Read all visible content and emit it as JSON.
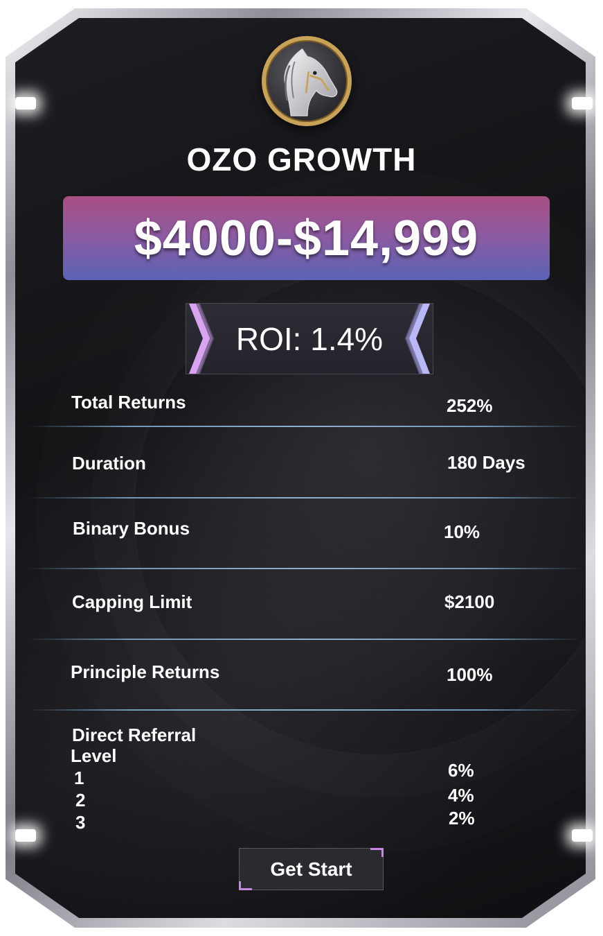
{
  "plan": {
    "title": "OZO GROWTH",
    "price_range": "$4000-$14,999",
    "roi": "ROI: 1.4%"
  },
  "details": [
    {
      "label": "Total Returns",
      "value": "252%"
    },
    {
      "label": "Duration",
      "value": "180 Days"
    },
    {
      "label": "Binary Bonus",
      "value": "10%"
    },
    {
      "label": "Capping Limit",
      "value": "$2100"
    },
    {
      "label": "Principle Returns",
      "value": "100%"
    }
  ],
  "referral": {
    "label": "Direct Referral",
    "level_label": "Level",
    "levels": [
      {
        "level": "1",
        "value": "6%"
      },
      {
        "level": "2",
        "value": "4%"
      },
      {
        "level": "3",
        "value": "2%"
      }
    ]
  },
  "cta": {
    "label": "Get Start"
  },
  "colors": {
    "banner_top": "#a94f83",
    "banner_bottom": "#5a63b6",
    "accent": "#c986e6",
    "logo_gold": "#c9a25a"
  },
  "icons": {
    "logo": "horse-head-icon",
    "roi_left": "chevron-right-icon",
    "roi_right": "chevron-left-icon"
  }
}
